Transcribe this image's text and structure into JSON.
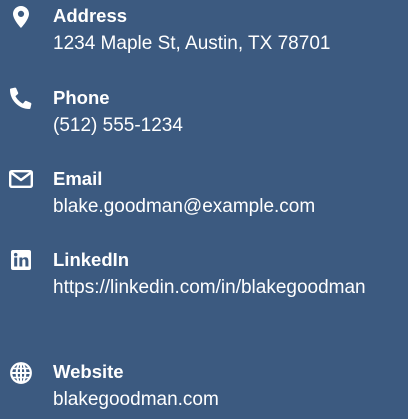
{
  "contact": {
    "items": [
      {
        "icon": "map-pin-icon",
        "label": "Address",
        "value": "1234 Maple St, Austin, TX 78701"
      },
      {
        "icon": "phone-icon",
        "label": "Phone",
        "value": "(512) 555-1234"
      },
      {
        "icon": "envelope-icon",
        "label": "Email",
        "value": "blake.goodman@example.com"
      },
      {
        "icon": "linkedin-icon",
        "label": "LinkedIn",
        "value": "https://linkedin.com/in/blakegoodman"
      },
      {
        "icon": "globe-icon",
        "label": "Website",
        "value": "blakegoodman.com"
      }
    ]
  },
  "colors": {
    "background": "#3c5a80",
    "text": "#ffffff"
  }
}
